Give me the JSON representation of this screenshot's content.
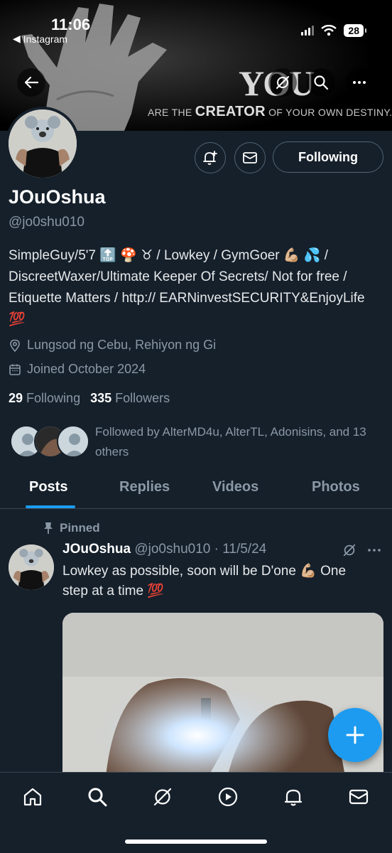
{
  "status_bar": {
    "time": "11:06",
    "back_app": "Instagram",
    "battery": "28"
  },
  "banner": {
    "quote_big": "YOU",
    "quote_pre": "ARE THE",
    "quote_emph": "CREATOR",
    "quote_post": "OF YOUR OWN DESTINY."
  },
  "profile": {
    "display_name": "JOuOshua",
    "handle": "@jo0shu010",
    "bio": "SimpleGuy/5'7 🔝 🍄 ♉ / Lowkey / GymGoer 💪🏼 💦 / DiscreetWaxer/Ultimate Keeper Of Secrets/ Not for free / Etiquette Matters / http:// EARNinvestSECURITY&EnjoyLife 💯",
    "location": "Lungsod ng Cebu, Rehiyon ng Gi",
    "joined": "Joined October 2024",
    "following_count": "29",
    "following_label": "Following",
    "followers_count": "335",
    "followers_label": "Followers",
    "followed_by": "Followed by AlterMD4u, AlterTL, Adonisins, and 13 others",
    "following_button": "Following"
  },
  "tabs": [
    {
      "label": "Posts",
      "active": true
    },
    {
      "label": "Replies",
      "active": false
    },
    {
      "label": "Videos",
      "active": false
    },
    {
      "label": "Photos",
      "active": false
    }
  ],
  "post": {
    "pinned_label": "Pinned",
    "author_name": "JOuOshua",
    "author_handle": "@jo0shu010",
    "date": "· 11/5/24",
    "text": "Lowkey as possible, soon will be D'one 💪🏼 One step at a time 💯"
  },
  "colors": {
    "background": "#15202b",
    "accent": "#1d9bf0",
    "secondary_text": "#8b98a5",
    "border": "#38444d"
  },
  "icons": [
    "back-arrow-icon",
    "grok-icon",
    "search-icon",
    "more-icon",
    "notification-bell-plus-icon",
    "mail-icon",
    "location-pin-icon",
    "calendar-icon",
    "pin-icon",
    "home-icon",
    "search-icon",
    "grok-icon",
    "play-icon",
    "bell-icon",
    "mail-icon",
    "plus-icon"
  ]
}
